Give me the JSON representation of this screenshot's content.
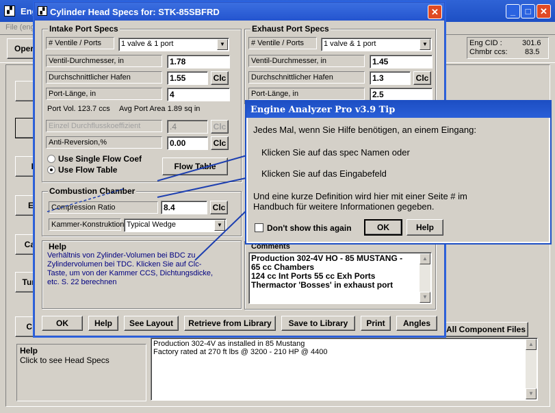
{
  "main": {
    "title": "Eng",
    "menu_file": "File (eng",
    "open_label": "Oper",
    "eng_cid_label": "Eng CID :",
    "eng_cid_value": "301.6",
    "chmbr_label": "Chmbr ccs:",
    "chmbr_value": "83.5",
    "left_buttons": [
      "I",
      "E",
      "Ca",
      "Tur",
      "C"
    ],
    "all_component_files": "All Component Files",
    "help_title": "Help",
    "help_text": "Click to see Head Specs",
    "notes_line1": "Production 302-4V as installed in 85 Mustang",
    "notes_line2": "Factory rated at 270 ft lbs @ 3200 - 210 HP @ 4400"
  },
  "dialog": {
    "title": "Cylinder Head Specs for: STK-85SBFRD",
    "intake": {
      "group_title": "Intake Port Specs",
      "valves_label": "# Ventile / Ports",
      "valves_value": "1 valve & 1 port",
      "diameter_label": "Ventil-Durchmesser, in",
      "diameter_value": "1.78",
      "avg_label": "Durchschnittlicher Hafen",
      "avg_value": "1.55",
      "length_label": "Port-Länge, in",
      "length_value": "4",
      "port_vol": "Port Vol. 123.7 ccs",
      "avg_area": "Avg Port Area 1.89 sq in",
      "flow_coef_label": "Einzel Durchflusskoeffizient",
      "flow_coef_value": ".4",
      "anti_rev_label": "Anti-Reversion,%",
      "anti_rev_value": "0.00",
      "radio_single": "Use Single Flow Coef",
      "radio_table": "Use Flow Table",
      "flow_table_button": "Flow Table",
      "clc": "Clc"
    },
    "exhaust": {
      "group_title": "Exhaust Port Specs",
      "valves_label": "# Ventile / Ports",
      "valves_value": "1 valve & 1 port",
      "diameter_label": "Ventil-Durchmesser, in",
      "diameter_value": "1.45",
      "avg_label": "Durchschnittlicher Hafen",
      "avg_value": "1.3",
      "length_label": "Port-Länge, in",
      "length_value": "2.5"
    },
    "combustion": {
      "group_title": "Combustion Chamber",
      "ratio_label": "Compression Ratio",
      "ratio_value": "8.4",
      "kammer_label": "Kammer-Konstruktion",
      "kammer_value": "Typical Wedge"
    },
    "help": {
      "title": "Help",
      "text": "Verhältnis von Zylinder-Volumen bei BDC zu Zylindervolumen bei TDC. Klicken Sie auf Clc-Taste, um von der Kammer CCS, Dichtungsdicke, etc. S. 22 berechnen"
    },
    "comments": {
      "title": "Comments",
      "line1": "Production 302-4V  HO - 85 MUSTANG -",
      "line2": "65 cc Chambers",
      "line3": "124 cc Int Ports  55 cc Exh Ports",
      "line4": "Thermactor 'Bosses' in exhaust port"
    },
    "buttons": {
      "ok": "OK",
      "help": "Help",
      "see_layout": "See Layout",
      "retrieve": "Retrieve from Library",
      "save": "Save to Library",
      "print": "Print",
      "angles": "Angles"
    }
  },
  "tip": {
    "title": "Engine Analyzer Pro v3.9 Tip",
    "line1": "Jedes Mal, wenn Sie Hilfe benötigen, an einem Eingang:",
    "line2": "Klicken Sie auf das spec Namen oder",
    "line3": "Klicken Sie auf das Eingabefeld",
    "line4": "Und eine kurze Definition wird hier mit einer Seite # im",
    "line5": "Handbuch für weitere Informationen gegeben.",
    "dont_show": "Don't show this again",
    "ok": "OK",
    "help": "Help"
  }
}
